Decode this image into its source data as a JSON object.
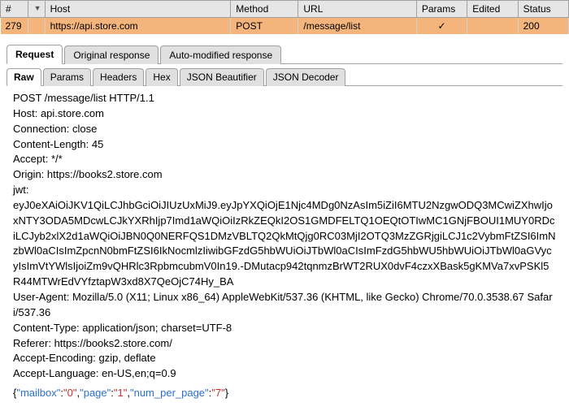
{
  "table": {
    "headers": [
      "#",
      "Host",
      "Method",
      "URL",
      "Params",
      "Edited",
      "Status"
    ],
    "dot_header_sort": "▼",
    "row": {
      "num": "279",
      "host": "https://api.store.com",
      "method": "POST",
      "url": "/message/list",
      "params": "✓",
      "edited": "",
      "status": "200"
    }
  },
  "outer_tabs": [
    "Request",
    "Original response",
    "Auto-modified response"
  ],
  "inner_tabs": [
    "Raw",
    "Params",
    "Headers",
    "Hex",
    "JSON Beautifier",
    "JSON Decoder"
  ],
  "raw_request": "POST /message/list HTTP/1.1\nHost: api.store.com\nConnection: close\nContent-Length: 45\nAccept: */*\nOrigin: https://books2.store.com\njwt:\neyJ0eXAiOiJKV1QiLCJhbGciOiJIUzUxMiJ9.eyJpYXQiOjE1Njc4MDg0NzAsIm5iZiI6MTU2NzgwODQ3MCwiZXhwIjoxNTY3ODA5MDcwLCJkYXRhIjp7Imd1aWQiOiIzRkZEQkI2OS1GMDFELTQ1OEQtOTIwMC1GNjFBOUI1MUY0RDciLCJyb2xlX2d1aWQiOiJBN0Q0NERFQS1DMzVBLTQ2QkMtQjg0RC03MjI2OTQ3MzZGRjgiLCJ1c2VybmFtZSI6ImNzbWl0aCIsImZpcnN0bmFtZSI6IkNocmlzIiwibGFzdG5hbWUiOiJTbWl0aCIsImFzdG5hbWU5hbWUiOiJTbWl0aGVycyIsImVtYWlsIjoiZm9vQHRlc3RpbmcubmV0In19.-DMutacp942tqnmzBrWT2RUX0dvF4czxXBask5gKMVa7xvPSKl5R44MTWrEdVYfztapW3xd8X7QeOjC74Hy_BA\nUser-Agent: Mozilla/5.0 (X11; Linux x86_64) AppleWebKit/537.36 (KHTML, like Gecko) Chrome/70.0.3538.67 Safari/537.36\nContent-Type: application/json; charset=UTF-8\nReferer: https://books2.store.com/\nAccept-Encoding: gzip, deflate\nAccept-Language: en-US,en;q=0.9",
  "json_body": {
    "mailbox": "0",
    "page": "1",
    "num_per_page": "7"
  }
}
